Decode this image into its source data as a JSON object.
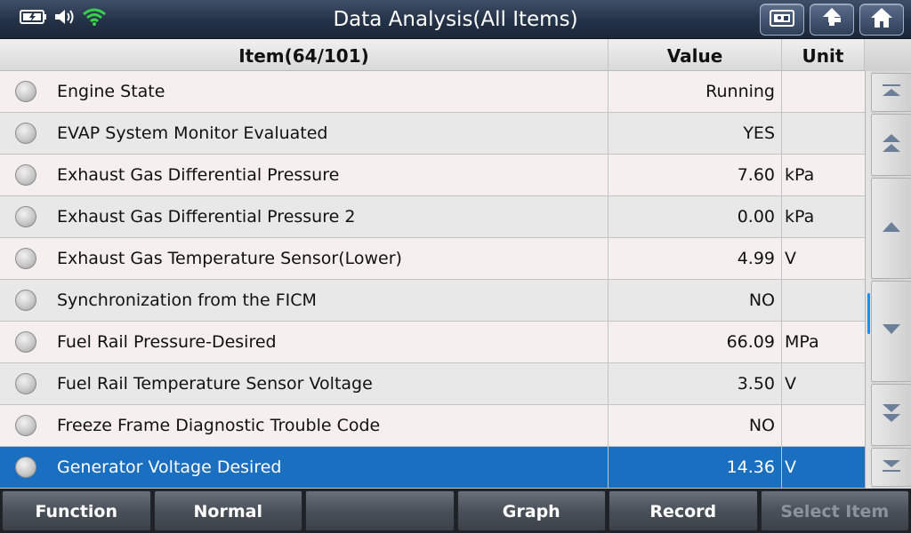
{
  "header": {
    "title": "Data Analysis(All Items)"
  },
  "table": {
    "columns": {
      "item": "Item(64/101)",
      "value": "Value",
      "unit": "Unit"
    },
    "rows": [
      {
        "name": "Engine State",
        "value": "Running",
        "unit": ""
      },
      {
        "name": "EVAP System Monitor Evaluated",
        "value": "YES",
        "unit": ""
      },
      {
        "name": "Exhaust Gas Differential Pressure",
        "value": "7.60",
        "unit": "kPa"
      },
      {
        "name": "Exhaust Gas Differential Pressure 2",
        "value": "0.00",
        "unit": "kPa"
      },
      {
        "name": "Exhaust Gas Temperature Sensor(Lower)",
        "value": "4.99",
        "unit": "V"
      },
      {
        "name": "Synchronization from the FICM",
        "value": "NO",
        "unit": ""
      },
      {
        "name": "Fuel Rail Pressure-Desired",
        "value": "66.09",
        "unit": "MPa"
      },
      {
        "name": "Fuel Rail Temperature Sensor Voltage",
        "value": "3.50",
        "unit": "V"
      },
      {
        "name": "Freeze Frame Diagnostic Trouble Code",
        "value": "NO",
        "unit": ""
      },
      {
        "name": "Generator Voltage Desired",
        "value": "14.36",
        "unit": "V"
      }
    ],
    "selected_index": 9
  },
  "toolbar": {
    "buttons": [
      "Function",
      "Normal",
      "",
      "Graph",
      "Record",
      "Select Item"
    ],
    "disabled": [
      "Select Item"
    ]
  },
  "icons": {
    "status": [
      "battery-icon",
      "speaker-icon",
      "wifi-icon"
    ],
    "top_buttons": [
      "screenshot-icon",
      "back-icon",
      "home-icon"
    ],
    "scroll": [
      "scroll-top-icon",
      "page-up-icon",
      "scroll-up-icon",
      "scroll-down-icon",
      "page-down-icon",
      "scroll-bottom-icon"
    ]
  },
  "colors": {
    "selected_row": "#1b6fc0",
    "wifi": "#39d14a",
    "scroll_thumb": "#1e90e8"
  }
}
